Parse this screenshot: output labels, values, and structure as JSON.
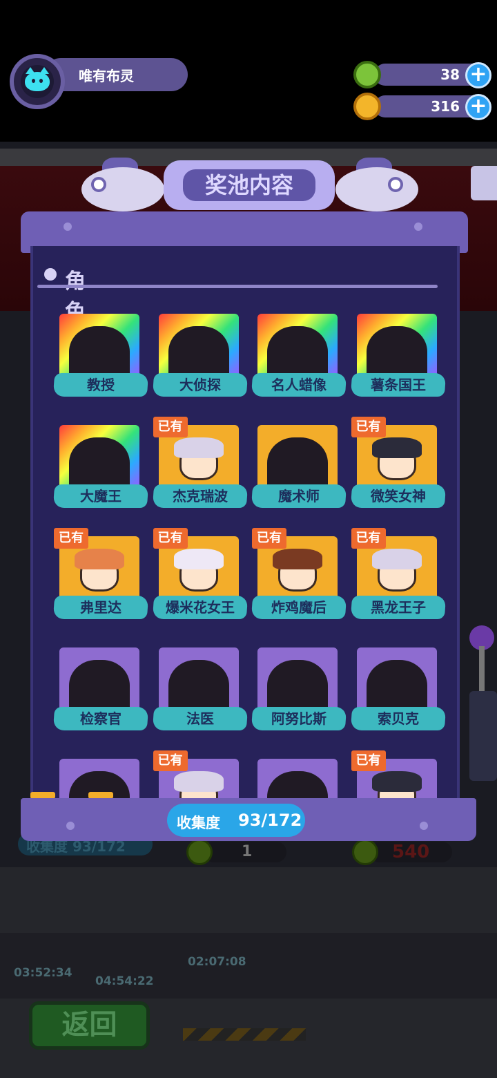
{
  "player": {
    "name": "唯有布灵",
    "avatar_icon": "cat-avatar-icon"
  },
  "currencies": [
    {
      "icon": "green-gear-coin-icon",
      "value": "38",
      "color": "#7cc43a"
    },
    {
      "icon": "planet-coin-icon",
      "value": "316",
      "color": "#f3b52a"
    }
  ],
  "panel": {
    "title": "奖池内容",
    "section": "角色",
    "collection_label": "收集度",
    "collection_value": "93/172"
  },
  "characters": [
    {
      "name": "教授",
      "rarity": "rainbow",
      "owned": false
    },
    {
      "name": "大侦探",
      "rarity": "rainbow",
      "owned": false
    },
    {
      "name": "名人蜡像",
      "rarity": "rainbow",
      "owned": false
    },
    {
      "name": "薯条国王",
      "rarity": "rainbow",
      "owned": false
    },
    {
      "name": "大魔王",
      "rarity": "rainbow",
      "owned": false
    },
    {
      "name": "杰克瑞波",
      "rarity": "gold",
      "owned": true
    },
    {
      "name": "魔术师",
      "rarity": "gold",
      "owned": false
    },
    {
      "name": "微笑女神",
      "rarity": "gold",
      "owned": true
    },
    {
      "name": "弗里达",
      "rarity": "gold",
      "owned": true
    },
    {
      "name": "爆米花女王",
      "rarity": "gold",
      "owned": true
    },
    {
      "name": "炸鸡魔后",
      "rarity": "gold",
      "owned": true
    },
    {
      "name": "黑龙王子",
      "rarity": "gold",
      "owned": true
    },
    {
      "name": "检察官",
      "rarity": "purple",
      "owned": false
    },
    {
      "name": "法医",
      "rarity": "purple",
      "owned": false
    },
    {
      "name": "阿努比斯",
      "rarity": "purple",
      "owned": false
    },
    {
      "name": "索贝克",
      "rarity": "purple",
      "owned": false
    },
    {
      "name": "",
      "rarity": "purple",
      "owned": false
    },
    {
      "name": "",
      "rarity": "purple",
      "owned": true
    },
    {
      "name": "",
      "rarity": "purple",
      "owned": false
    },
    {
      "name": "",
      "rarity": "purple",
      "owned": true
    }
  ],
  "owned_label": "已有",
  "background": {
    "collect_text": "收集度 93/172",
    "coin_left_value": "1",
    "coin_right_value": "540",
    "timers": [
      "03:52:34",
      "04:54:22",
      "02:07:08"
    ],
    "back_label": "返回"
  }
}
